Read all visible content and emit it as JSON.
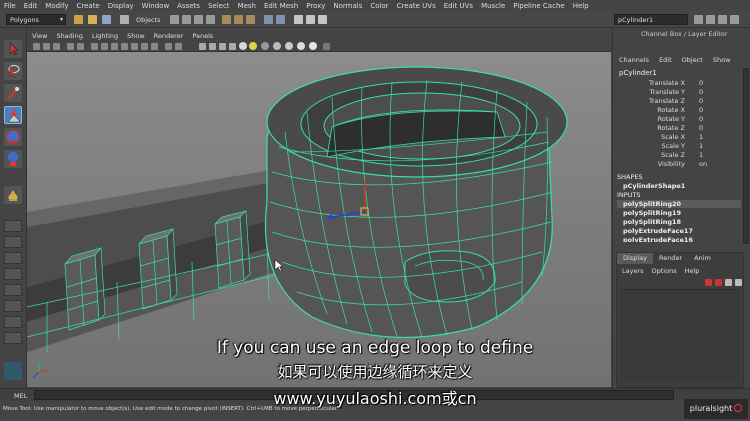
{
  "menubar": {
    "items": [
      "File",
      "Edit",
      "Modify",
      "Create",
      "Display",
      "Window",
      "Assets",
      "Select",
      "Mesh",
      "Edit Mesh",
      "Proxy",
      "Normals",
      "Color",
      "Create UVs",
      "Edit UVs",
      "Muscle",
      "Pipeline Cache",
      "Help"
    ]
  },
  "statusline": {
    "mode": "Polygons",
    "selection_mode": "Objects",
    "name_field": "pCylinder1"
  },
  "viewport": {
    "menu": [
      "View",
      "Shading",
      "Lighting",
      "Show",
      "Renderer",
      "Panels"
    ]
  },
  "channel_box": {
    "title": "Channel Box / Layer Editor",
    "tabs": [
      "Channels",
      "Edit",
      "Object",
      "Show"
    ],
    "object_name": "pCylinder1",
    "attributes": [
      {
        "name": "Translate X",
        "value": "0"
      },
      {
        "name": "Translate Y",
        "value": "0"
      },
      {
        "name": "Translate Z",
        "value": "0"
      },
      {
        "name": "Rotate X",
        "value": "0"
      },
      {
        "name": "Rotate Y",
        "value": "0"
      },
      {
        "name": "Rotate Z",
        "value": "0"
      },
      {
        "name": "Scale X",
        "value": "1"
      },
      {
        "name": "Scale Y",
        "value": "1"
      },
      {
        "name": "Scale Z",
        "value": "1"
      },
      {
        "name": "Visibility",
        "value": "on"
      }
    ],
    "shapes_label": "SHAPES",
    "shape_node": "pCylinderShape1",
    "inputs_label": "INPUTS",
    "inputs": [
      "polySplitRing20",
      "polySplitRing19",
      "polySplitRing18",
      "polyExtrudeFace17",
      "polyExtrudeFace16"
    ]
  },
  "layer_editor": {
    "tabs": [
      "Display",
      "Render",
      "Anim"
    ],
    "active_tab": "Display",
    "menu": [
      "Layers",
      "Options",
      "Help"
    ]
  },
  "command_line": {
    "label": "MEL"
  },
  "help_line": {
    "text": "Move Tool: Use manipulator to move object(s). Use edit mode to change pivot (INSERT). Ctrl+LMB to move perpendicular."
  },
  "subtitles": {
    "english": "If you can use an edge loop to define",
    "chinese": "如果可以使用边缘循环来定义",
    "url": "www.yuyulaoshi.com或cn"
  },
  "watermark": {
    "text": "pluralsight"
  },
  "colors": {
    "wireframe": "#38e0a8",
    "mesh": "#5a5a5a",
    "ui_bg": "#444444",
    "selected_tool": "#4a7fc0"
  }
}
